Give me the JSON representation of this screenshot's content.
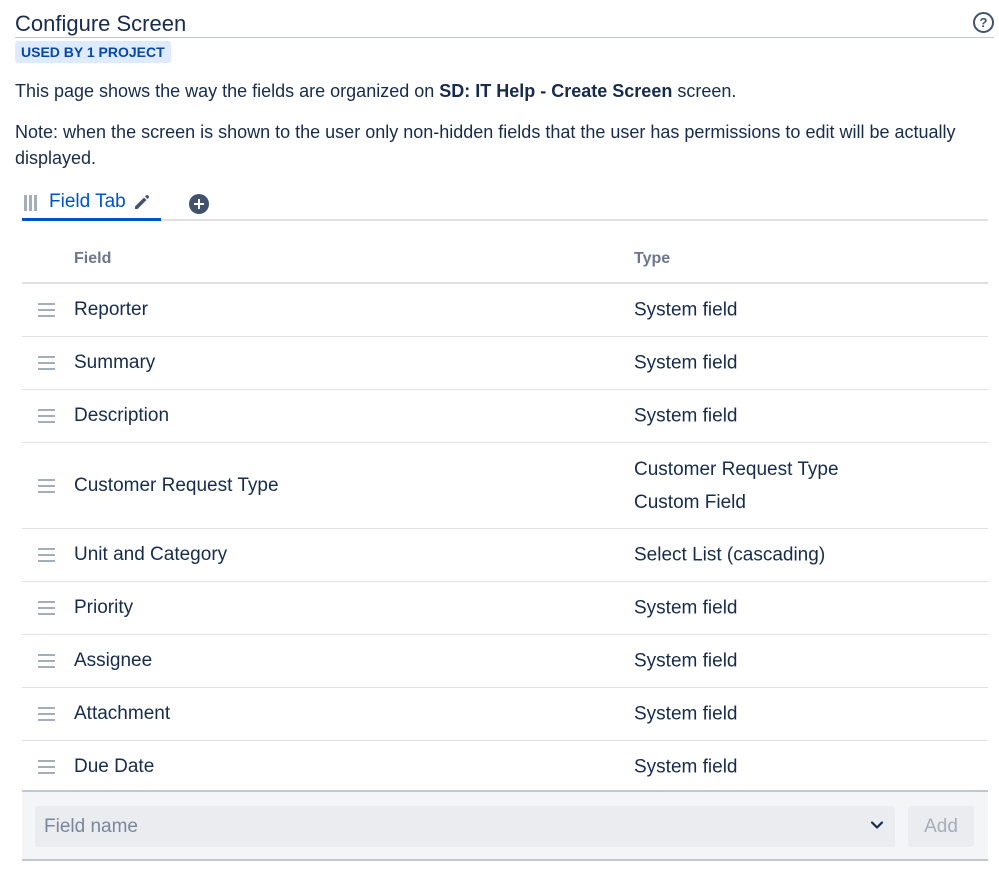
{
  "header": {
    "title": "Configure Screen",
    "help_icon": "question-circle-icon"
  },
  "usage_lozenge": "USED BY 1 PROJECT",
  "description": {
    "prefix": "This page shows the way the fields are organized on ",
    "screen_name": "SD: IT Help - Create Screen",
    "suffix": " screen."
  },
  "note": "Note: when the screen is shown to the user only non-hidden fields that the user has permissions to edit will be actually displayed.",
  "tabs": [
    {
      "label": "Field Tab",
      "active": true
    }
  ],
  "table": {
    "headers": {
      "field": "Field",
      "type": "Type"
    },
    "rows": [
      {
        "field": "Reporter",
        "type": [
          "System field"
        ]
      },
      {
        "field": "Summary",
        "type": [
          "System field"
        ]
      },
      {
        "field": "Description",
        "type": [
          "System field"
        ]
      },
      {
        "field": "Customer Request Type",
        "type": [
          "Customer Request Type",
          "Custom Field"
        ]
      },
      {
        "field": "Unit and Category",
        "type": [
          "Select List (cascading)"
        ]
      },
      {
        "field": "Priority",
        "type": [
          "System field"
        ]
      },
      {
        "field": "Assignee",
        "type": [
          "System field"
        ]
      },
      {
        "field": "Attachment",
        "type": [
          "System field"
        ]
      },
      {
        "field": "Due Date",
        "type": [
          "System field"
        ]
      }
    ]
  },
  "add_field": {
    "placeholder": "Field name",
    "button_label": "Add"
  },
  "colors": {
    "accent": "#0052cc",
    "text": "#172b4d",
    "subtle": "#6b778c",
    "lozenge_bg": "#deebff",
    "lozenge_text": "#0747a6"
  }
}
